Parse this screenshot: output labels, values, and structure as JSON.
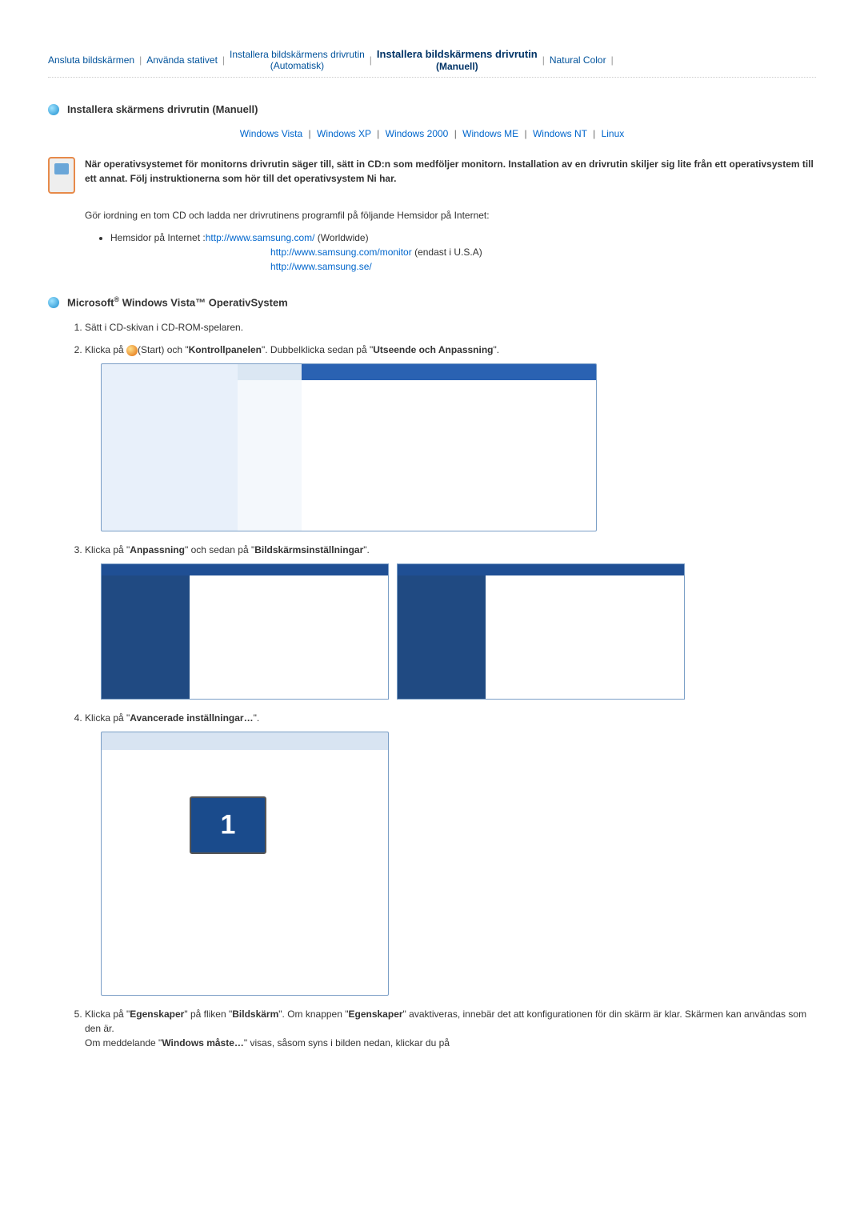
{
  "topnav": {
    "items": [
      {
        "label": "Ansluta bildskärmen",
        "sub": ""
      },
      {
        "label": "Använda stativet",
        "sub": ""
      },
      {
        "label": "Installera bildskärmens drivrutin",
        "sub": "(Automatisk)"
      },
      {
        "label": "Installera bildskärmens drivrutin",
        "sub": "(Manuell)"
      },
      {
        "label": "Natural Color",
        "sub": ""
      }
    ]
  },
  "section1_title": "Installera skärmens drivrutin (Manuell)",
  "anchors": {
    "vista": "Windows Vista",
    "xp": "Windows XP",
    "w2000": "Windows 2000",
    "me": "Windows ME",
    "nt": "Windows NT",
    "linux": "Linux"
  },
  "notice": "När operativsystemet för monitorns drivrutin säger till, sätt in CD:n som medföljer monitorn. Installation av en drivrutin skiljer sig lite från ett operativsystem till ett annat. Följ instruktionerna som hör till det operativsystem Ni har.",
  "prep_para": "Gör iordning en tom CD och ladda ner drivrutinens programfil på följande Hemsidor på Internet:",
  "links_intro": "Hemsidor på Internet :",
  "link1_text": "http://www.samsung.com/",
  "link1_tail": " (Worldwide)",
  "link2_text": "http://www.samsung.com/monitor",
  "link2_tail": " (endast i U.S.A)",
  "link3_text": "http://www.samsung.se/",
  "section2_prefix": "Microsoft",
  "section2_suffix": " Windows Vista™ OperativSystem",
  "steps": {
    "s1": "Sätt i CD-skivan i CD-ROM-spelaren.",
    "s2_a": "Klicka på ",
    "s2_b": "(Start) och \"",
    "s2_c": "Kontrollpanelen",
    "s2_d": "\". Dubbelklicka sedan på \"",
    "s2_e": "Utseende och Anpassning",
    "s2_f": "\".",
    "s3_a": "Klicka på \"",
    "s3_b": "Anpassning",
    "s3_c": "\" och sedan på \"",
    "s3_d": "Bildskärmsinställningar",
    "s3_e": "\".",
    "s4_a": "Klicka på \"",
    "s4_b": "Avancerade inställningar…",
    "s4_c": "\".",
    "s5_a": "Klicka på \"",
    "s5_b": "Egenskaper",
    "s5_c": "\" på fliken \"",
    "s5_d": "Bildskärm",
    "s5_e": "\". Om knappen \"",
    "s5_f": "Egenskaper",
    "s5_g": "\" avaktiveras, innebär det att konfigurationen för din skärm är klar. Skärmen kan användas som den är.",
    "s5_h": "Om meddelande \"",
    "s5_i": "Windows måste…",
    "s5_j": "\" visas, såsom syns i bilden nedan, klickar du på"
  }
}
